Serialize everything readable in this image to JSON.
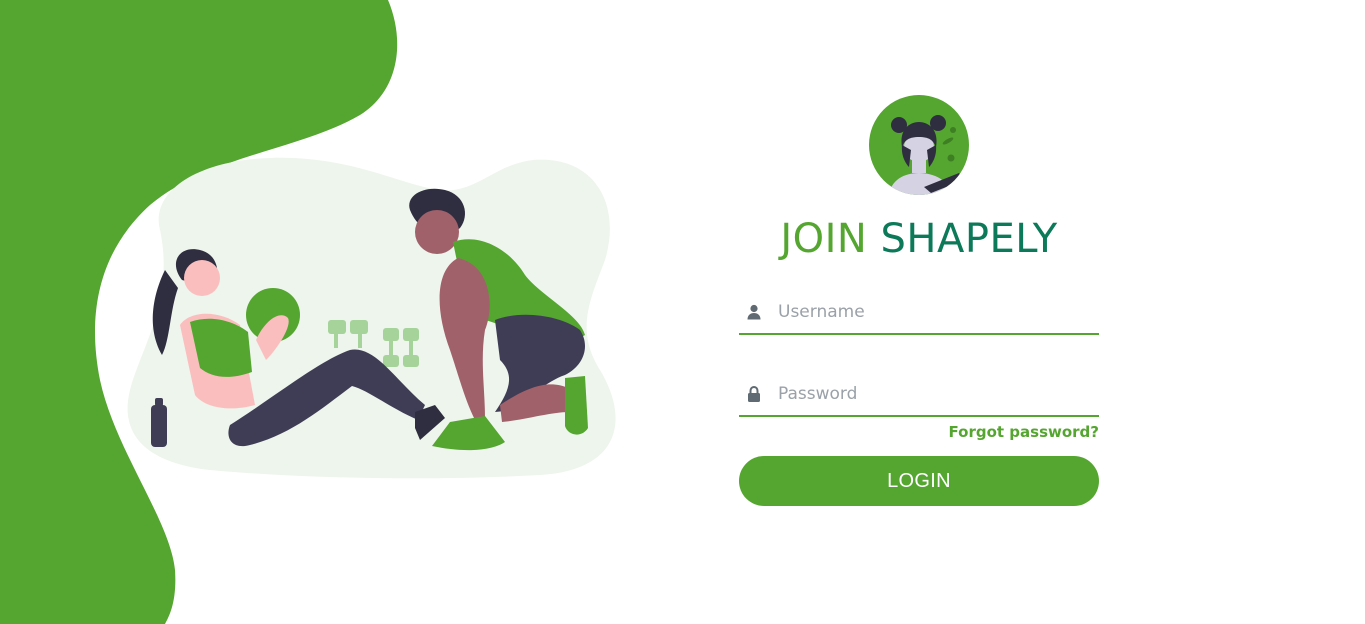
{
  "brand": {
    "title_part1": "JOIN",
    "title_part2": "SHAPELY"
  },
  "form": {
    "username_placeholder": "Username",
    "password_placeholder": "Password",
    "forgot_password": "Forgot password?",
    "login_label": "LOGIN"
  },
  "icons": {
    "username": "user-icon",
    "password": "lock-icon"
  },
  "colors": {
    "primary_green": "#55a630",
    "dark_green": "#0c7a58",
    "placeholder_gray": "#9aa1a8",
    "illustration_bg": "#eef5ec"
  }
}
